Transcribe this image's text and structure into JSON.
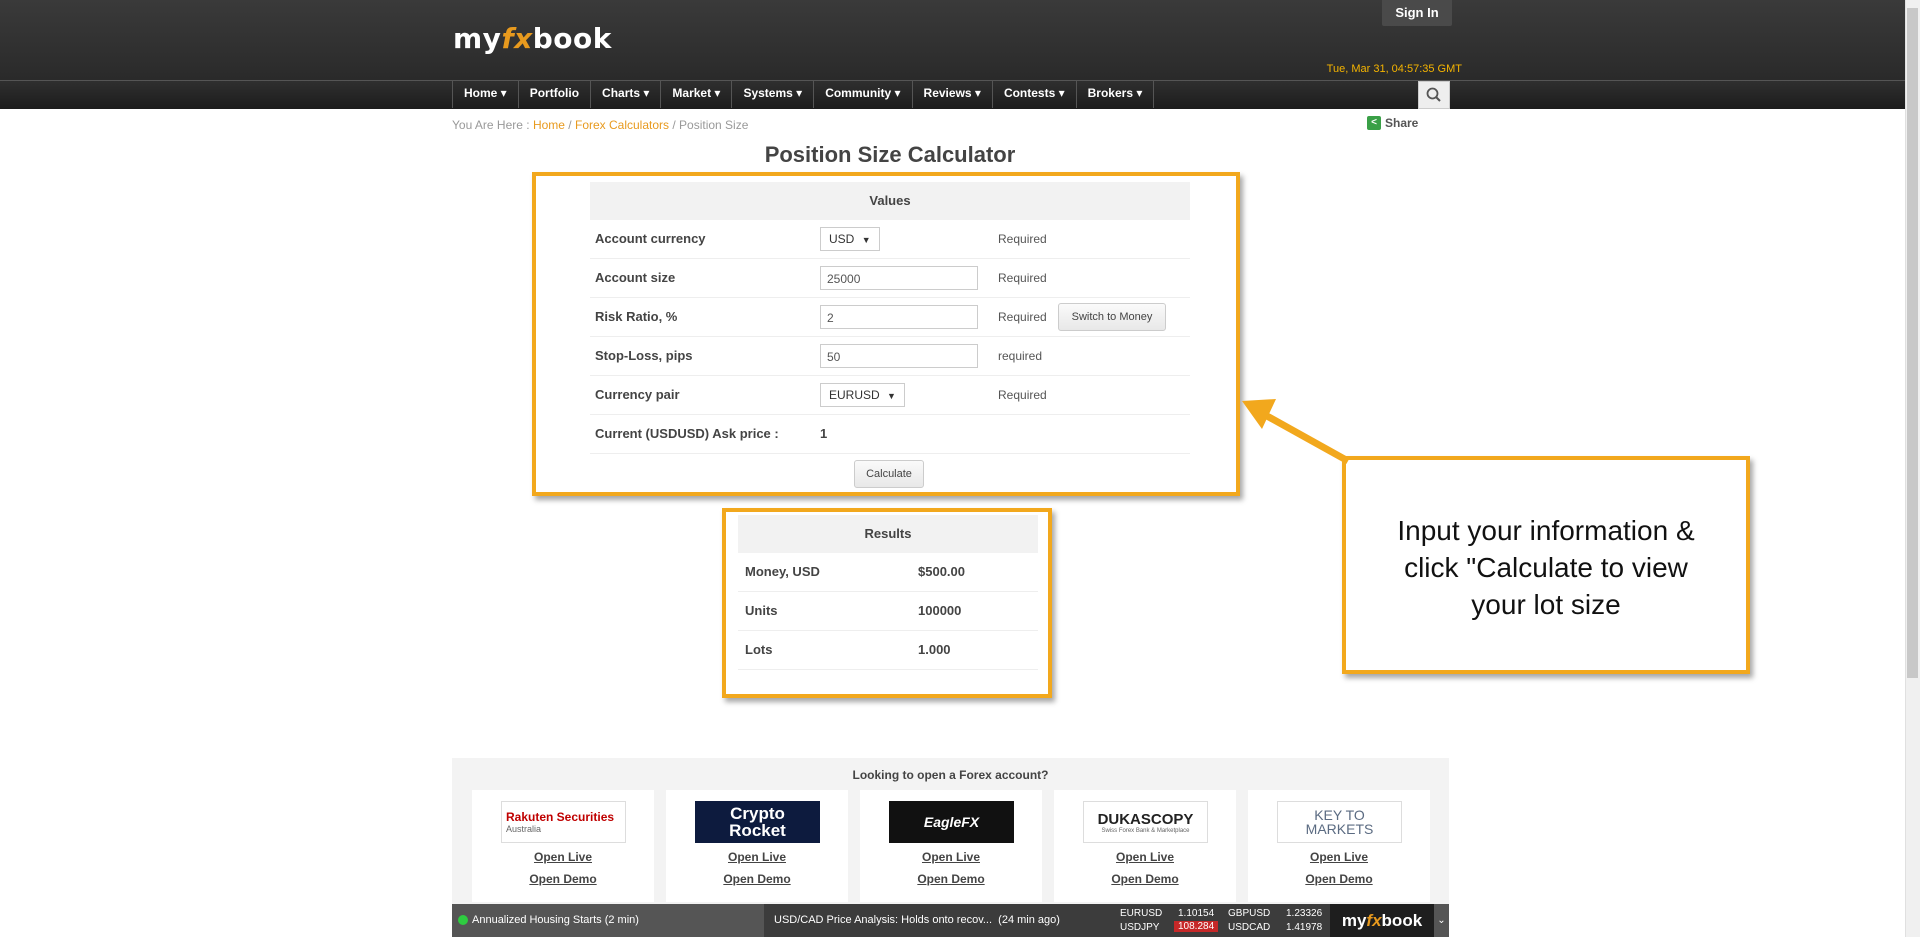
{
  "header": {
    "logo_pre": "my",
    "logo_fx": "fx",
    "logo_post": "book",
    "sign_in": "Sign In",
    "datetime": "Tue, Mar 31, 04:57:35 GMT"
  },
  "nav": [
    "Home ▾",
    "Portfolio",
    "Charts ▾",
    "Market ▾",
    "Systems ▾",
    "Community ▾",
    "Reviews ▾",
    "Contests ▾",
    "Brokers ▾"
  ],
  "breadcrumb": {
    "prefix": "You Are Here : ",
    "home": "Home",
    "sep1": " / ",
    "calc": "Forex Calculators",
    "sep2": " / ",
    "current": "Position Size"
  },
  "share": "Share",
  "title": "Position Size Calculator",
  "values": {
    "header": "Values",
    "account_currency": {
      "label": "Account currency",
      "value": "USD",
      "note": "Required"
    },
    "account_size": {
      "label": "Account size",
      "value": "25000",
      "note": "Required"
    },
    "risk_ratio": {
      "label": "Risk Ratio, %",
      "value": "2",
      "note": "Required",
      "button": "Switch to Money"
    },
    "stop_loss": {
      "label": "Stop-Loss, pips",
      "value": "50",
      "note": "required"
    },
    "currency_pair": {
      "label": "Currency pair",
      "value": "EURUSD",
      "note": "Required"
    },
    "ask_price": {
      "label": "Current (USDUSD) Ask price :",
      "value": "1"
    },
    "calculate": "Calculate"
  },
  "results": {
    "header": "Results",
    "rows": [
      {
        "label": "Money, USD",
        "value": "$500.00"
      },
      {
        "label": "Units",
        "value": "100000"
      },
      {
        "label": "Lots",
        "value": "1.000"
      }
    ]
  },
  "callout": {
    "line1": "Input your information &",
    "line2": "click \"Calculate to view",
    "line3": "your lot size"
  },
  "brokers": {
    "title": "Looking to open a Forex account?",
    "open_live": "Open Live",
    "open_demo": "Open Demo",
    "items": [
      {
        "line1": "Rakuten Securities",
        "line2": "Australia"
      },
      {
        "line1": "Crypto",
        "line2": "Rocket"
      },
      {
        "line1": "EagleFX",
        "line2": ""
      },
      {
        "line1": "DUKASCOPY",
        "line2": "Swiss Forex Bank & Marketplace"
      },
      {
        "line1": "KEY TO",
        "line2": "MARKETS"
      }
    ]
  },
  "ticker": {
    "item1": "Annualized Housing Starts (2 min)",
    "item2_title": "USD/CAD Price Analysis: Holds onto recov...",
    "item2_time": "(24 min ago)",
    "quotes": [
      {
        "pair": "EURUSD",
        "price": "1.10154"
      },
      {
        "pair": "GBPUSD",
        "price": "1.23326"
      },
      {
        "pair": "USDJPY",
        "price": "108.284"
      },
      {
        "pair": "USDCAD",
        "price": "1.41978"
      }
    ],
    "chevron": "⌄"
  },
  "colors": {
    "accent": "#f2a81d",
    "link": "#e89a1e",
    "header_bg": "#2f2f2f",
    "down_price_bg": "#c62828"
  }
}
